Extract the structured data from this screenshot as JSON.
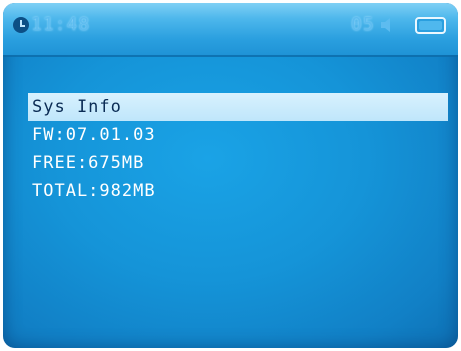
{
  "status_bar": {
    "time": "11:48",
    "volume": "05",
    "icons": [
      "clock-icon",
      "speaker-icon",
      "battery-icon"
    ]
  },
  "menu": {
    "title": "Sys Info",
    "items": [
      {
        "label": "FW:07.01.03"
      },
      {
        "label": "FREE:675MB"
      },
      {
        "label": "TOTAL:982MB"
      }
    ]
  },
  "colors": {
    "screen_blue": "#1594d8",
    "highlight": "#cdebfc",
    "text": "#ffffff"
  }
}
